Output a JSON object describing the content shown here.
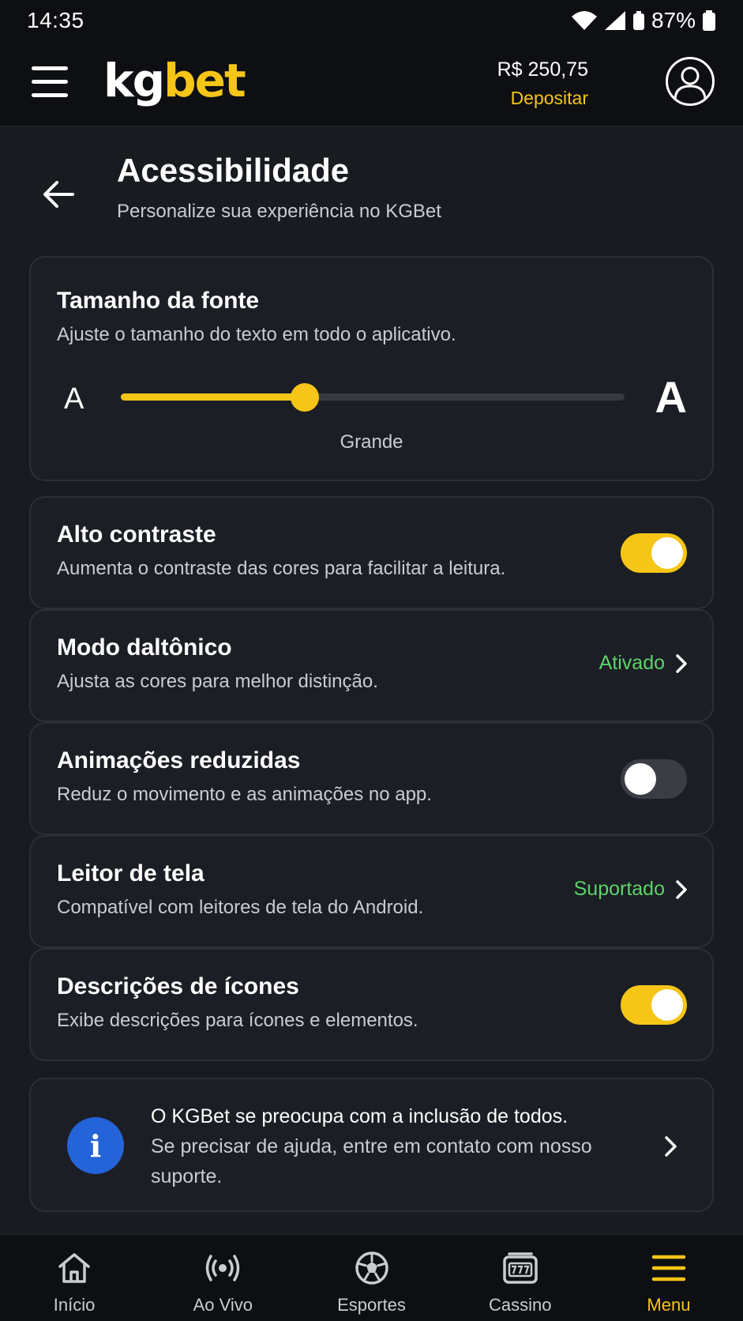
{
  "status_bar": {
    "time": "14:35",
    "battery": "87%"
  },
  "header": {
    "logo_part1": "kg",
    "logo_part2": "bet",
    "balance": "R$ 250,75",
    "deposit_label": "Depositar"
  },
  "page": {
    "title": "Acessibilidade",
    "subtitle": "Personalize sua experiência no KGBet"
  },
  "font_size": {
    "title": "Tamanho da fonte",
    "description": "Ajuste o tamanho do texto em todo o aplicativo.",
    "small_label": "A",
    "large_label": "A",
    "value_label": "Grande",
    "level": 0.365
  },
  "settings": [
    {
      "title": "Alto contraste",
      "description": "Aumenta o contraste das cores para facilitar a leitura.",
      "type": "toggle",
      "on": true
    },
    {
      "title": "Modo daltônico",
      "description": "Ajusta as cores para melhor distinção.",
      "type": "link",
      "status": "Ativado"
    },
    {
      "title": "Animações reduzidas",
      "description": "Reduz o movimento e as animações no app.",
      "type": "toggle",
      "on": false
    },
    {
      "title": "Leitor de tela",
      "description": "Compatível com leitores de tela do Android.",
      "type": "link",
      "status": "Suportado"
    },
    {
      "title": "Descrições de ícones",
      "description": "Exibe descrições para ícones e elementos.",
      "type": "toggle",
      "on": true
    }
  ],
  "info": {
    "icon_letter": "i",
    "line1": "O KGBet se preocupa com a inclusão de todos.",
    "line2": "Se precisar de ajuda, entre em contato com nosso suporte."
  },
  "bottom_nav": [
    {
      "label": "Início",
      "icon": "home-icon",
      "active": false
    },
    {
      "label": "Ao Vivo",
      "icon": "live-broadcast-icon",
      "active": false
    },
    {
      "label": "Esportes",
      "icon": "soccer-ball-icon",
      "active": false
    },
    {
      "label": "Cassino",
      "icon": "slot-machine-icon",
      "active": false
    },
    {
      "label": "Menu",
      "icon": "menu-icon",
      "active": true
    }
  ],
  "colors": {
    "accent": "#f5c518",
    "status_green": "#5dd36a",
    "info_blue": "#2563d8",
    "background": "#181b20"
  }
}
